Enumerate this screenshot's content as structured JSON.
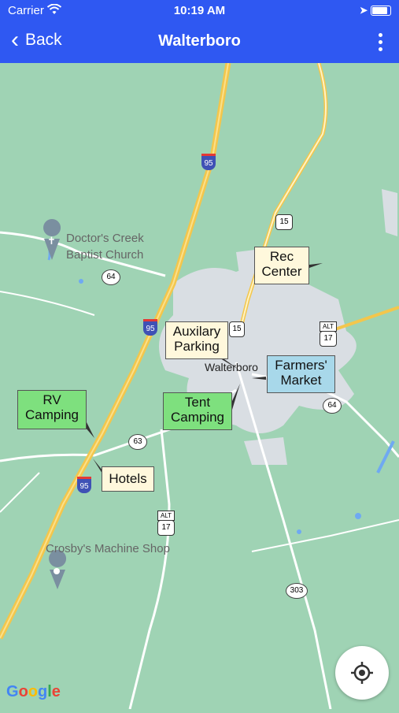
{
  "status": {
    "carrier": "Carrier",
    "time": "10:19 AM"
  },
  "nav": {
    "back_label": "Back",
    "title": "Walterboro"
  },
  "map": {
    "markers": [
      {
        "id": "rec-center",
        "text": "Rec\nCenter",
        "style": "cream"
      },
      {
        "id": "auxilary-parking",
        "text": "Auxilary\nParking",
        "style": "cream"
      },
      {
        "id": "farmers-market",
        "text": "Farmers'\nMarket",
        "style": "blue"
      },
      {
        "id": "rv-camping",
        "text": "RV\nCamping",
        "style": "green"
      },
      {
        "id": "tent-camping",
        "text": "Tent\nCamping",
        "style": "green"
      },
      {
        "id": "hotels",
        "text": "Hotels",
        "style": "cream"
      }
    ],
    "places": {
      "doctors_creek_line1": "Doctor's Creek",
      "doctors_creek_line2": "Baptist Church",
      "crosbys": "Crosby's Machine Shop",
      "walterboro": "Walterboro"
    },
    "shields": {
      "i95_a": "95",
      "i95_b": "95",
      "i95_c": "95",
      "us15_a": "15",
      "us15_b": "15",
      "sc64_a": "64",
      "sc64_b": "64",
      "sc63": "63",
      "alt17_a": "17",
      "alt17_b": "17",
      "alt_label": "ALT",
      "sc303": "303"
    },
    "attribution": [
      "G",
      "o",
      "o",
      "g",
      "l",
      "e"
    ],
    "colors": {
      "land": "#9fd3b4",
      "town": "#d9dee3",
      "interstate": "#f3c64c",
      "water": "#6fa9f2"
    }
  }
}
